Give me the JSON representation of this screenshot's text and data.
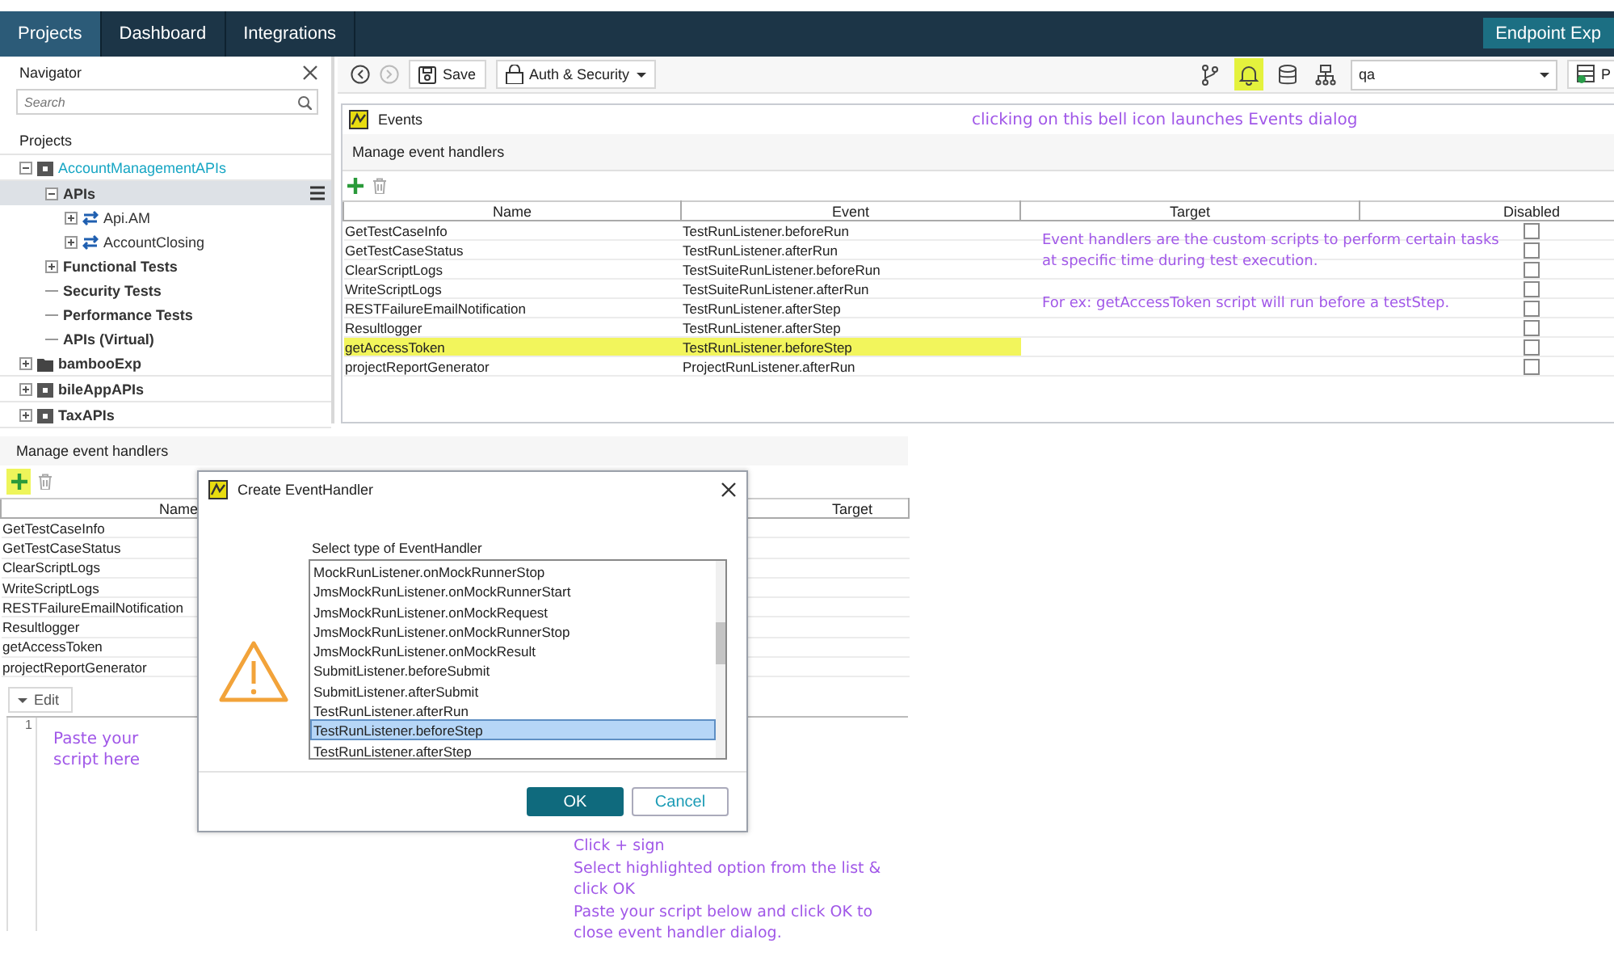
{
  "header": {
    "tabs": [
      {
        "label": "Projects",
        "selected": true
      },
      {
        "label": "Dashboard",
        "selected": false
      },
      {
        "label": "Integrations",
        "selected": false
      }
    ],
    "endpoint_button": "Endpoint Exp"
  },
  "navigator": {
    "title": "Navigator",
    "search_placeholder": "Search",
    "section": "Projects",
    "tree": [
      {
        "label": "AccountManagementAPIs",
        "kind": "project",
        "expanded": true,
        "selected": false,
        "children": [
          {
            "label": "APIs",
            "kind": "group",
            "expanded": true,
            "selected": true,
            "children": [
              {
                "label": "Api.AM",
                "kind": "api",
                "expanded": false,
                "selected": false
              },
              {
                "label": "AccountClosing",
                "kind": "api",
                "expanded": false,
                "selected": false
              }
            ]
          },
          {
            "label": "Functional Tests",
            "kind": "group",
            "expanded": false,
            "selected": false
          },
          {
            "label": "Security Tests",
            "kind": "group",
            "selected": false
          },
          {
            "label": "Performance Tests",
            "kind": "group",
            "selected": false
          },
          {
            "label": "APIs (Virtual)",
            "kind": "group",
            "selected": false
          }
        ]
      },
      {
        "label": "bambooExp",
        "kind": "folder",
        "expanded": false,
        "selected": false
      },
      {
        "label": "bileAppAPIs",
        "kind": "project",
        "expanded": false,
        "selected": false
      },
      {
        "label": "TaxAPIs",
        "kind": "project",
        "expanded": false,
        "selected": false
      }
    ]
  },
  "toolbar": {
    "save": "Save",
    "auth": "Auth & Security",
    "bell_highlighted": true,
    "environment": "qa",
    "cut_button": "P"
  },
  "events": {
    "title": "Events",
    "note": "clicking on this bell icon launches Events dialog",
    "subtitle": "Manage event handlers",
    "columns": [
      "Name",
      "Event",
      "Target",
      "Disabled"
    ],
    "rows": [
      {
        "name": "GetTestCaseInfo",
        "event": "TestRunListener.beforeRun",
        "disabled": false,
        "highlighted": false
      },
      {
        "name": "GetTestCaseStatus",
        "event": "TestRunListener.afterRun",
        "disabled": false,
        "highlighted": false
      },
      {
        "name": "ClearScriptLogs",
        "event": "TestSuiteRunListener.beforeRun",
        "disabled": false,
        "highlighted": false
      },
      {
        "name": "WriteScriptLogs",
        "event": "TestSuiteRunListener.afterRun",
        "disabled": false,
        "highlighted": false
      },
      {
        "name": "RESTFailureEmailNotification",
        "event": "TestRunListener.afterStep",
        "disabled": false,
        "highlighted": false
      },
      {
        "name": "Resultlogger",
        "event": "TestRunListener.afterStep",
        "disabled": false,
        "highlighted": false
      },
      {
        "name": "getAccessToken",
        "event": "TestRunListener.beforeStep",
        "disabled": false,
        "highlighted": true
      },
      {
        "name": "projectReportGenerator",
        "event": "ProjectRunListener.afterRun",
        "disabled": false,
        "highlighted": false
      }
    ],
    "handlers_note": [
      "Event handlers are the custom scripts to perform certain tasks at specific time during test execution.",
      "For ex: getAccessToken script will run before a testStep."
    ]
  },
  "lower": {
    "subtitle": "Manage event handlers",
    "add_highlighted": true,
    "columns": [
      "Name",
      "Target"
    ],
    "rows": [
      "GetTestCaseInfo",
      "GetTestCaseStatus",
      "ClearScriptLogs",
      "WriteScriptLogs",
      "RESTFailureEmailNotification",
      "Resultlogger",
      "getAccessToken",
      "projectReportGenerator"
    ],
    "edit_tab": "Edit",
    "line_number": "1",
    "editor_note": "Paste your script here"
  },
  "dialog": {
    "title": "Create EventHandler",
    "label": "Select type of EventHandler",
    "options": [
      {
        "label": "MockRunListener.onMockRunnerStop",
        "selected": false
      },
      {
        "label": "JmsMockRunListener.onMockRunnerStart",
        "selected": false
      },
      {
        "label": "JmsMockRunListener.onMockRequest",
        "selected": false
      },
      {
        "label": "JmsMockRunListener.onMockRunnerStop",
        "selected": false
      },
      {
        "label": "JmsMockRunListener.onMockResult",
        "selected": false
      },
      {
        "label": "SubmitListener.beforeSubmit",
        "selected": false
      },
      {
        "label": "SubmitListener.afterSubmit",
        "selected": false
      },
      {
        "label": "TestRunListener.afterRun",
        "selected": false
      },
      {
        "label": "TestRunListener.beforeStep",
        "selected": true
      },
      {
        "label": "TestRunListener.afterStep",
        "selected": false
      }
    ],
    "ok": "OK",
    "cancel": "Cancel"
  },
  "steps_note": [
    "Click + sign",
    "Select highlighted option from the list & click OK",
    "Paste your script below and click OK to close event handler dialog."
  ]
}
